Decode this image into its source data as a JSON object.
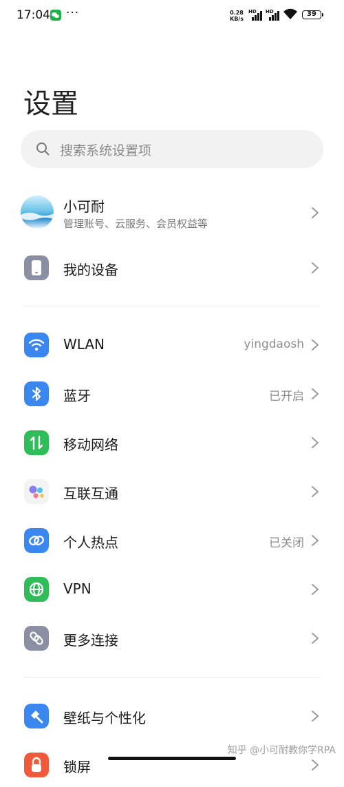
{
  "status_bar": {
    "time": "17:04",
    "more": "···",
    "net_speed_value": "0.28",
    "net_speed_unit": "KB/s",
    "hd1": "HD",
    "hd2": "HD",
    "battery": "39"
  },
  "header": {
    "title": "设置"
  },
  "search": {
    "placeholder": "搜索系统设置项"
  },
  "profile": {
    "name": "小可耐",
    "subtitle": "管理账号、云服务、会员权益等"
  },
  "items": [
    {
      "label": "我的设备",
      "value": "",
      "icon": "device-icon",
      "color": "#8a8fa3"
    },
    {
      "label": "WLAN",
      "value": "yingdaosh",
      "icon": "wifi-icon",
      "color": "#3a87f0"
    },
    {
      "label": "蓝牙",
      "value": "已开启",
      "icon": "bluetooth-icon",
      "color": "#3a87f0"
    },
    {
      "label": "移动网络",
      "value": "",
      "icon": "mobile-data-icon",
      "color": "#2fbd5a"
    },
    {
      "label": "互联互通",
      "value": "",
      "icon": "interconnect-icon",
      "color": "#f3f3f3"
    },
    {
      "label": "个人热点",
      "value": "已关闭",
      "icon": "hotspot-icon",
      "color": "#3a87f0"
    },
    {
      "label": "VPN",
      "value": "",
      "icon": "globe-icon",
      "color": "#2fbd5a"
    },
    {
      "label": "更多连接",
      "value": "",
      "icon": "link-icon",
      "color": "#8a8fa3"
    },
    {
      "label": "壁纸与个性化",
      "value": "",
      "icon": "brush-icon",
      "color": "#3a87f0"
    },
    {
      "label": "锁屏",
      "value": "",
      "icon": "lock-icon",
      "color": "#f05a3a"
    }
  ],
  "watermark": "知乎 @小可耐教你学RPA"
}
